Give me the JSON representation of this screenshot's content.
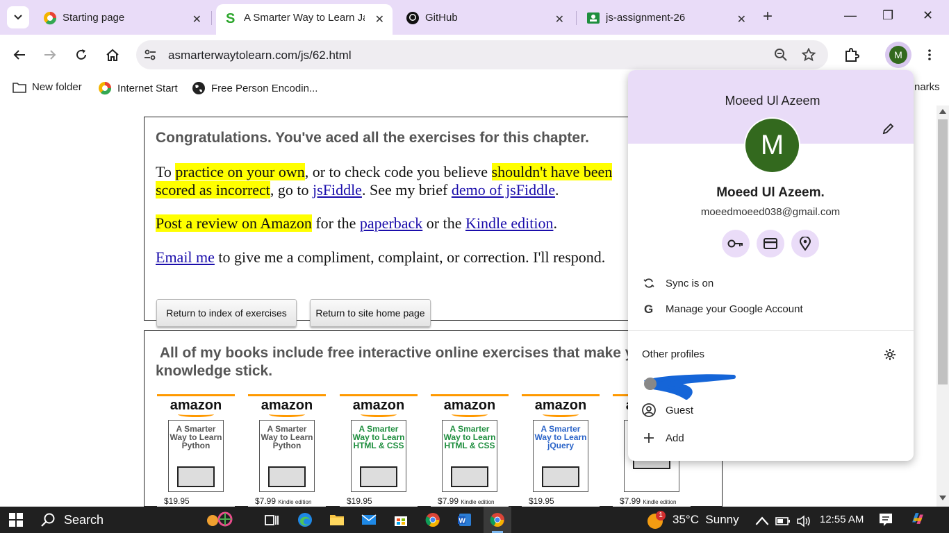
{
  "tabs": [
    {
      "title": "Starting page",
      "close": "✕"
    },
    {
      "title": "A Smarter Way to Learn Ja",
      "close": "✕"
    },
    {
      "title": "GitHub",
      "close": "✕"
    },
    {
      "title": "js-assignment-26",
      "close": "✕"
    }
  ],
  "newtab": "+",
  "window": {
    "minimize": "—",
    "restore": "❐",
    "close": "✕"
  },
  "omnibox": {
    "url": "asmarterwaytolearn.com/js/62.html"
  },
  "profile_initial": "M",
  "bookmarks": [
    {
      "label": "New folder"
    },
    {
      "label": "Internet Start"
    },
    {
      "label": "Free Person Encodin..."
    },
    {
      "label": "narks"
    }
  ],
  "page": {
    "heading": "Congratulations. You've aced all the exercises for this chapter.",
    "p1": {
      "a": "To ",
      "b": "practice on your own",
      "c": ", or to check code you believe ",
      "d": "shouldn't have been",
      "e": "scored as incorrect",
      "f": ", go to ",
      "g": "jsFiddle",
      "h": ". See my brief ",
      "i": "demo of jsFiddle",
      "j": "."
    },
    "p2": {
      "a": "Post a review on Amazon",
      "b": " for the ",
      "c": "paperback",
      "d": " or the ",
      "e": "Kindle edition",
      "f": "."
    },
    "p3": {
      "a": "Email me",
      "b": " to give me a compliment, complaint, or correction. I'll respond."
    },
    "btn_index": "Return to index of exercises",
    "btn_home": "Return to site home page",
    "books_heading_1": "All of my books include free interactive online exercises that make your",
    "books_heading_2": "knowledge stick.",
    "books": [
      {
        "brand": "amazon",
        "title": "A Smarter Way to Learn Python",
        "price": "$19.95",
        "edition": ""
      },
      {
        "brand": "amazon",
        "title": "A Smarter Way to Learn Python",
        "price": "$7.99",
        "edition": "Kindle edition"
      },
      {
        "brand": "amazon",
        "title": "A Smarter Way to Learn HTML & CSS",
        "price": "$19.95",
        "edition": ""
      },
      {
        "brand": "amazon",
        "title": "A Smarter Way to Learn HTML & CSS",
        "price": "$7.99",
        "edition": "Kindle edition"
      },
      {
        "brand": "amazon",
        "title": "A Smarter Way to Learn jQuery",
        "price": "$19.95",
        "edition": ""
      },
      {
        "brand": "amazon",
        "title": "",
        "price": "$7.99",
        "edition": "Kindle edition"
      }
    ]
  },
  "profile_panel": {
    "name": "Moeed Ul Azeem",
    "avatar_letter": "M",
    "full_name": "Moeed Ul Azeem.",
    "email": "moeedmoeed038@gmail.com",
    "sync": "Sync is on",
    "manage": "Manage your Google Account",
    "other_profiles": "Other profiles",
    "guest": "Guest",
    "add": "Add"
  },
  "taskbar": {
    "search": "Search",
    "weather": "35°C  Sunny",
    "weather_badge": "1",
    "time": "12:55 AM"
  },
  "colors": {
    "tabbar": "#e9dcf8",
    "avatar": "#33691e",
    "highlight": "#ffff00",
    "link": "#1a0dab"
  }
}
